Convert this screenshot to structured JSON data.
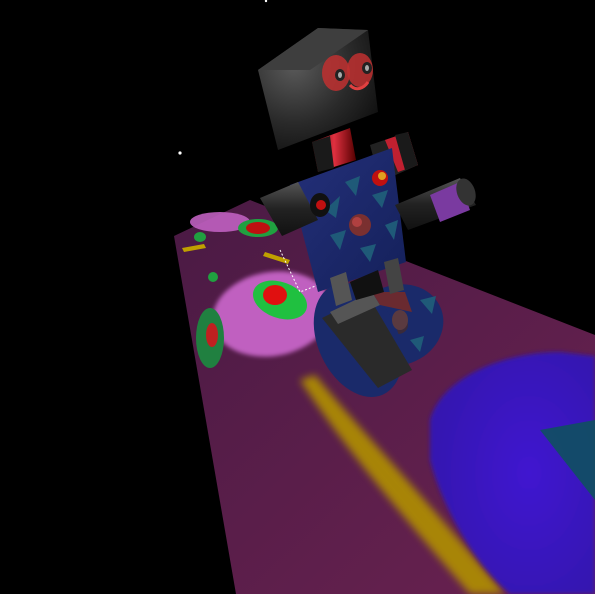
{
  "scene": {
    "background_color": "#000000",
    "floor_color": "#5a1f4a",
    "floor_pattern_colors": {
      "pink": "#c060c0",
      "green": "#20c040",
      "red": "#e01010",
      "yellow": "#c0a000",
      "blue": "#3a10c8",
      "teal": "#105060"
    },
    "robot": {
      "head_color": "#2a2a2a",
      "eye_color": "#c03030",
      "neck_color": "#c02030",
      "torso_color": "#1a2a6a",
      "arm_color": "#222222",
      "accent_purple": "#8040c0",
      "wheel_color": "#1a2a6a"
    },
    "stars": 2
  }
}
